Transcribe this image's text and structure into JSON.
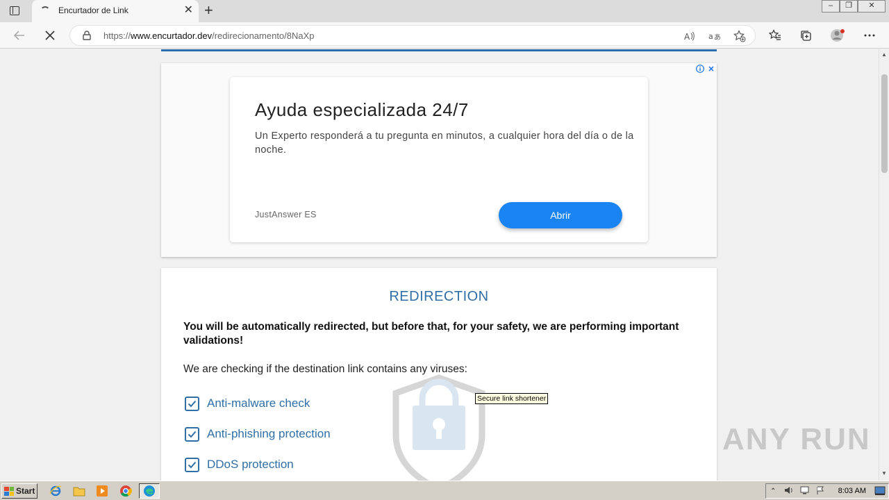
{
  "browser": {
    "tab_title": "Encurtador de Link",
    "url_scheme": "https://",
    "url_host": "www.encurtador.dev",
    "url_path": "/redirecionamento/8NaXp"
  },
  "ad": {
    "title": "Ayuda especializada 24/7",
    "description": "Un Experto responderá a tu pregunta en minutos, a cualquier hora del día o de la noche.",
    "source": "JustAnswer ES",
    "cta_label": "Abrir",
    "info_badge": "i",
    "close_badge": "✕"
  },
  "redirect": {
    "title": "REDIRECTION",
    "warning": "You will be automatically redirected, but before that, for your safety, we are performing important validations!",
    "checking_text": "We are checking if the destination link contains any viruses:",
    "checks": [
      "Anti-malware check",
      "Anti-phishing protection",
      "DDoS protection"
    ],
    "tooltip": "Secure link shortener"
  },
  "watermark": "ANY RUN",
  "taskbar": {
    "start_label": "Start",
    "clock": "8:03 AM"
  },
  "colors": {
    "accent": "#2f6fa6",
    "ad_button": "#1a84f5",
    "top_line": "#2a6db0"
  }
}
